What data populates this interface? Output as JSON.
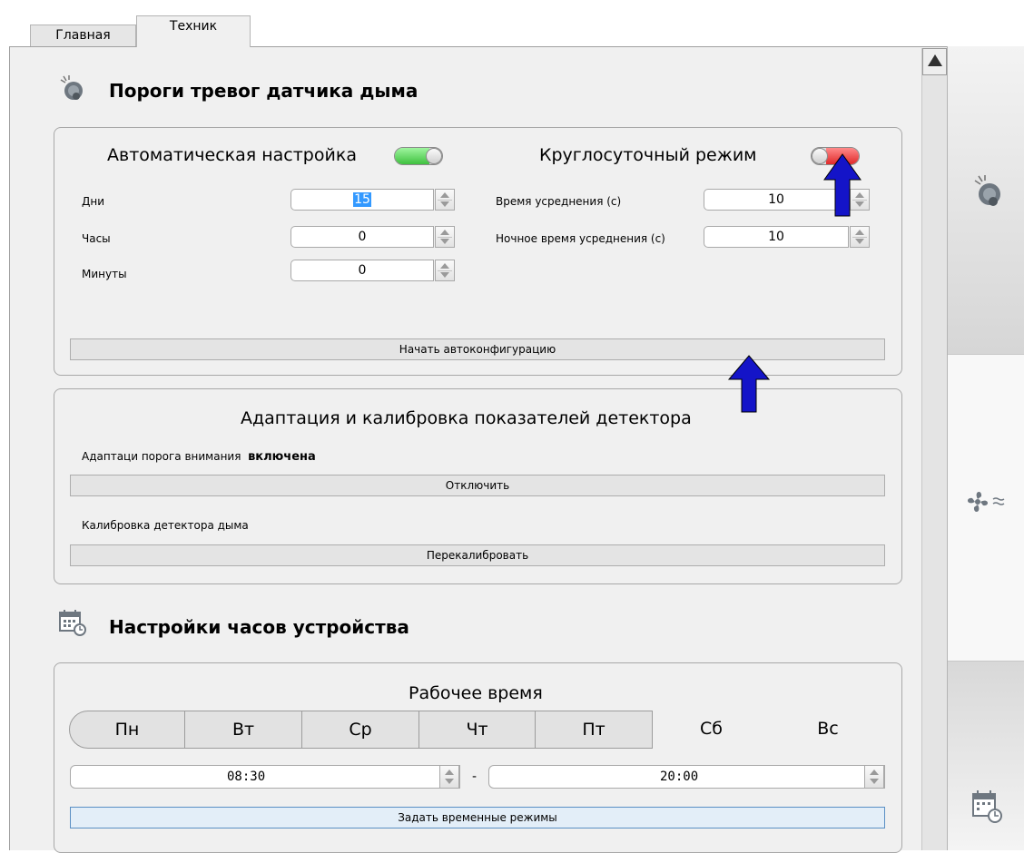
{
  "tabs": [
    {
      "label": "Главная",
      "active": false
    },
    {
      "label": "Техник",
      "active": true
    }
  ],
  "smoke_section": {
    "title": "Пороги тревог датчика дыма",
    "icon": "smoke-detector-icon"
  },
  "auto_group": {
    "auto_label": "Автоматическая настройка",
    "auto_toggle_on": true,
    "roundclock_label": "Круглосуточный режим",
    "roundclock_toggle_on": false,
    "days_label": "Дни",
    "days_value": "15",
    "hours_label": "Часы",
    "hours_value": "0",
    "minutes_label": "Минуты",
    "minutes_value": "0",
    "avg_label": "Время усреднения (с)",
    "avg_value": "10",
    "night_avg_label": "Ночное время усреднения (с)",
    "night_avg_value": "10",
    "start_button": "Начать автоконфигурацию"
  },
  "calib_group": {
    "title": "Адаптация и калибровка показателей детектора",
    "adapt_label": "Адаптаци порога внимания",
    "adapt_status": "включена",
    "disable_button": "Отключить",
    "calib_label": "Калибровка детектора дыма",
    "recalib_button": "Перекалибровать"
  },
  "clock_section": {
    "title": "Настройки часов устройства",
    "icon": "calendar-clock-icon"
  },
  "work_group": {
    "title": "Рабочее время",
    "days": [
      {
        "label": "Пн",
        "selected": true
      },
      {
        "label": "Вт",
        "selected": true
      },
      {
        "label": "Ср",
        "selected": true
      },
      {
        "label": "Чт",
        "selected": true
      },
      {
        "label": "Пт",
        "selected": true
      },
      {
        "label": "Сб",
        "selected": false
      },
      {
        "label": "Вс",
        "selected": false
      }
    ],
    "start_time": "08:30",
    "separator": "-",
    "end_time": "20:00",
    "set_button": "Задать временные режимы"
  },
  "sidebar": {
    "items": [
      {
        "icon": "smoke-detector-icon"
      },
      {
        "icon": "fan-airflow-icon"
      },
      {
        "icon": "calendar-clock-icon"
      }
    ]
  },
  "colors": {
    "toggle_on": "#5fd35f",
    "toggle_off": "#e84040",
    "annotation_arrow": "#1414c8"
  }
}
